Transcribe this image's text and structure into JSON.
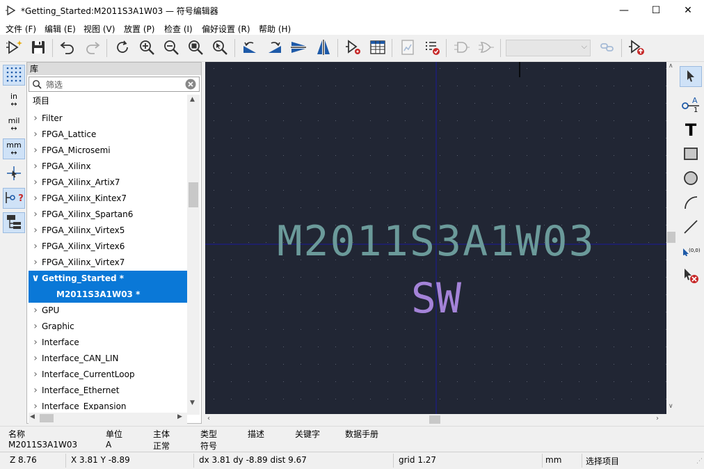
{
  "window": {
    "title": "*Getting_Started:M2011S3A1W03 — 符号编辑器",
    "minimize_glyph": "—",
    "maximize_glyph": "☐",
    "close_glyph": "✕"
  },
  "menu": {
    "items": [
      {
        "label": "文件 (F)"
      },
      {
        "label": "编辑 (E)"
      },
      {
        "label": "视图 (V)"
      },
      {
        "label": "放置 (P)"
      },
      {
        "label": "检查 (I)"
      },
      {
        "label": "偏好设置 (R)"
      },
      {
        "label": "帮助 (H)"
      }
    ]
  },
  "toolbar": {
    "icons": [
      "new-symbol-icon",
      "save-icon",
      "undo-icon",
      "redo-icon",
      "refresh-icon",
      "zoom-in-icon",
      "zoom-out-icon",
      "zoom-fit-icon",
      "zoom-selection-icon",
      "rotate-ccw-icon",
      "rotate-cw-icon",
      "mirror-vertical-icon",
      "mirror-horizontal-icon",
      "symbol-properties-icon",
      "pin-table-icon",
      "datasheet-icon",
      "check-symbol-icon",
      "de-morgan-standard-icon",
      "de-morgan-alternate-icon",
      "unit-select",
      "link-pins-icon",
      "export-symbol-icon"
    ],
    "unit_select_value": ""
  },
  "left_tools": {
    "in_label": "in",
    "mil_label": "mil",
    "mm_label": "mm",
    "pin_help_label": "?"
  },
  "library": {
    "header": "库",
    "filter_placeholder": "筛选",
    "column_header": "项目",
    "items": [
      {
        "label": "Filter",
        "expanded": false
      },
      {
        "label": "FPGA_Lattice",
        "expanded": false
      },
      {
        "label": "FPGA_Microsemi",
        "expanded": false
      },
      {
        "label": "FPGA_Xilinx",
        "expanded": false
      },
      {
        "label": "FPGA_Xilinx_Artix7",
        "expanded": false
      },
      {
        "label": "FPGA_Xilinx_Kintex7",
        "expanded": false
      },
      {
        "label": "FPGA_Xilinx_Spartan6",
        "expanded": false
      },
      {
        "label": "FPGA_Xilinx_Virtex5",
        "expanded": false
      },
      {
        "label": "FPGA_Xilinx_Virtex6",
        "expanded": false
      },
      {
        "label": "FPGA_Xilinx_Virtex7",
        "expanded": false
      },
      {
        "label": "Getting_Started *",
        "expanded": true,
        "selected": true
      },
      {
        "label": "M2011S3A1W03 *",
        "child": true,
        "selected": true
      },
      {
        "label": "GPU",
        "expanded": false
      },
      {
        "label": "Graphic",
        "expanded": false
      },
      {
        "label": "Interface",
        "expanded": false
      },
      {
        "label": "Interface_CAN_LIN",
        "expanded": false
      },
      {
        "label": "Interface_CurrentLoop",
        "expanded": false
      },
      {
        "label": "Interface_Ethernet",
        "expanded": false
      },
      {
        "label": "Interface_Expansion",
        "expanded": false
      }
    ]
  },
  "canvas": {
    "background": "#212634",
    "symbol_name": "M2011S3A1W03",
    "symbol_reference": "SW",
    "name_color": "#6b9a9a",
    "reference_color": "#a483d8",
    "axis_color": "#1a1a9a"
  },
  "right_tools": {
    "text_glyph": "T",
    "anchor_label": "(0,0)",
    "pin_label_a": "A",
    "pin_label_1": "1"
  },
  "message_panel": {
    "columns": [
      {
        "header": "名称",
        "value": "M2011S3A1W03"
      },
      {
        "header": "单位",
        "value": "A"
      },
      {
        "header": "主体",
        "value": "正常"
      },
      {
        "header": "类型",
        "value": "符号"
      },
      {
        "header": "描述",
        "value": ""
      },
      {
        "header": "关键字",
        "value": ""
      },
      {
        "header": "数据手册",
        "value": ""
      }
    ]
  },
  "status": {
    "zoom": "Z 8.76",
    "xy": "X 3.81  Y -8.89",
    "delta": "dx 3.81  dy -8.89  dist 9.67",
    "grid": "grid 1.27",
    "units": "mm",
    "mode": "选择项目"
  }
}
